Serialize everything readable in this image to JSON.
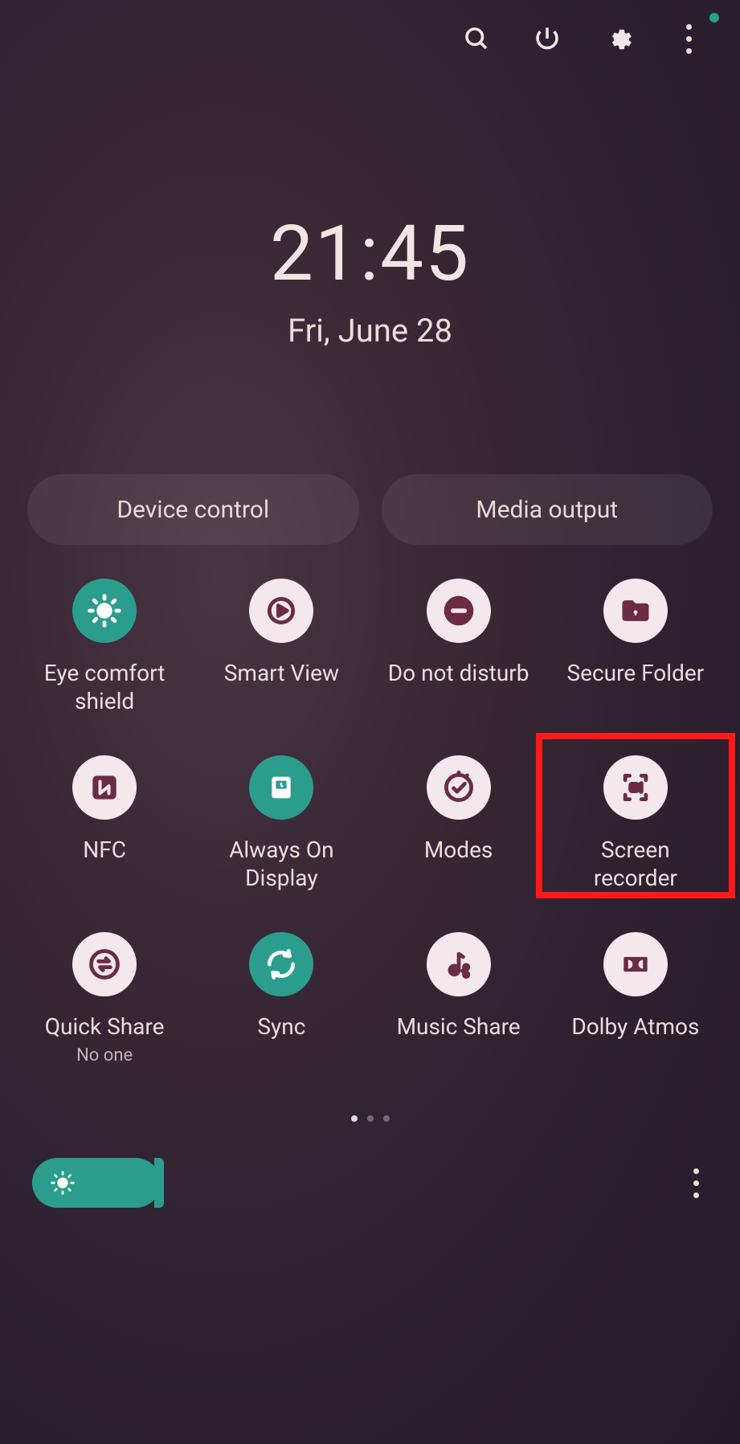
{
  "time": "21:45",
  "date": "Fri, June 28",
  "pills": {
    "device_control": "Device control",
    "media_output": "Media output"
  },
  "tiles": [
    {
      "id": "eye-comfort-shield",
      "label": "Eye comfort shield",
      "sublabel": "",
      "active": true,
      "icon": "sun"
    },
    {
      "id": "smart-view",
      "label": "Smart View",
      "sublabel": "",
      "active": false,
      "icon": "cast"
    },
    {
      "id": "do-not-disturb",
      "label": "Do not disturb",
      "sublabel": "",
      "active": false,
      "icon": "dnd"
    },
    {
      "id": "secure-folder",
      "label": "Secure Folder",
      "sublabel": "",
      "active": false,
      "icon": "folder-lock"
    },
    {
      "id": "nfc",
      "label": "NFC",
      "sublabel": "",
      "active": false,
      "icon": "nfc"
    },
    {
      "id": "always-on-display",
      "label": "Always On Display",
      "sublabel": "",
      "active": true,
      "icon": "clock"
    },
    {
      "id": "modes",
      "label": "Modes",
      "sublabel": "",
      "active": false,
      "icon": "check-circle"
    },
    {
      "id": "screen-recorder",
      "label": "Screen recorder",
      "sublabel": "",
      "active": false,
      "icon": "record"
    },
    {
      "id": "quick-share",
      "label": "Quick Share",
      "sublabel": "No one",
      "active": false,
      "icon": "swap"
    },
    {
      "id": "sync",
      "label": "Sync",
      "sublabel": "",
      "active": true,
      "icon": "sync"
    },
    {
      "id": "music-share",
      "label": "Music Share",
      "sublabel": "",
      "active": false,
      "icon": "music-share"
    },
    {
      "id": "dolby-atmos",
      "label": "Dolby Atmos",
      "sublabel": "",
      "active": false,
      "icon": "dolby"
    }
  ],
  "pager": {
    "count": 3,
    "active": 0
  },
  "highlight": {
    "tile_id": "screen-recorder"
  }
}
